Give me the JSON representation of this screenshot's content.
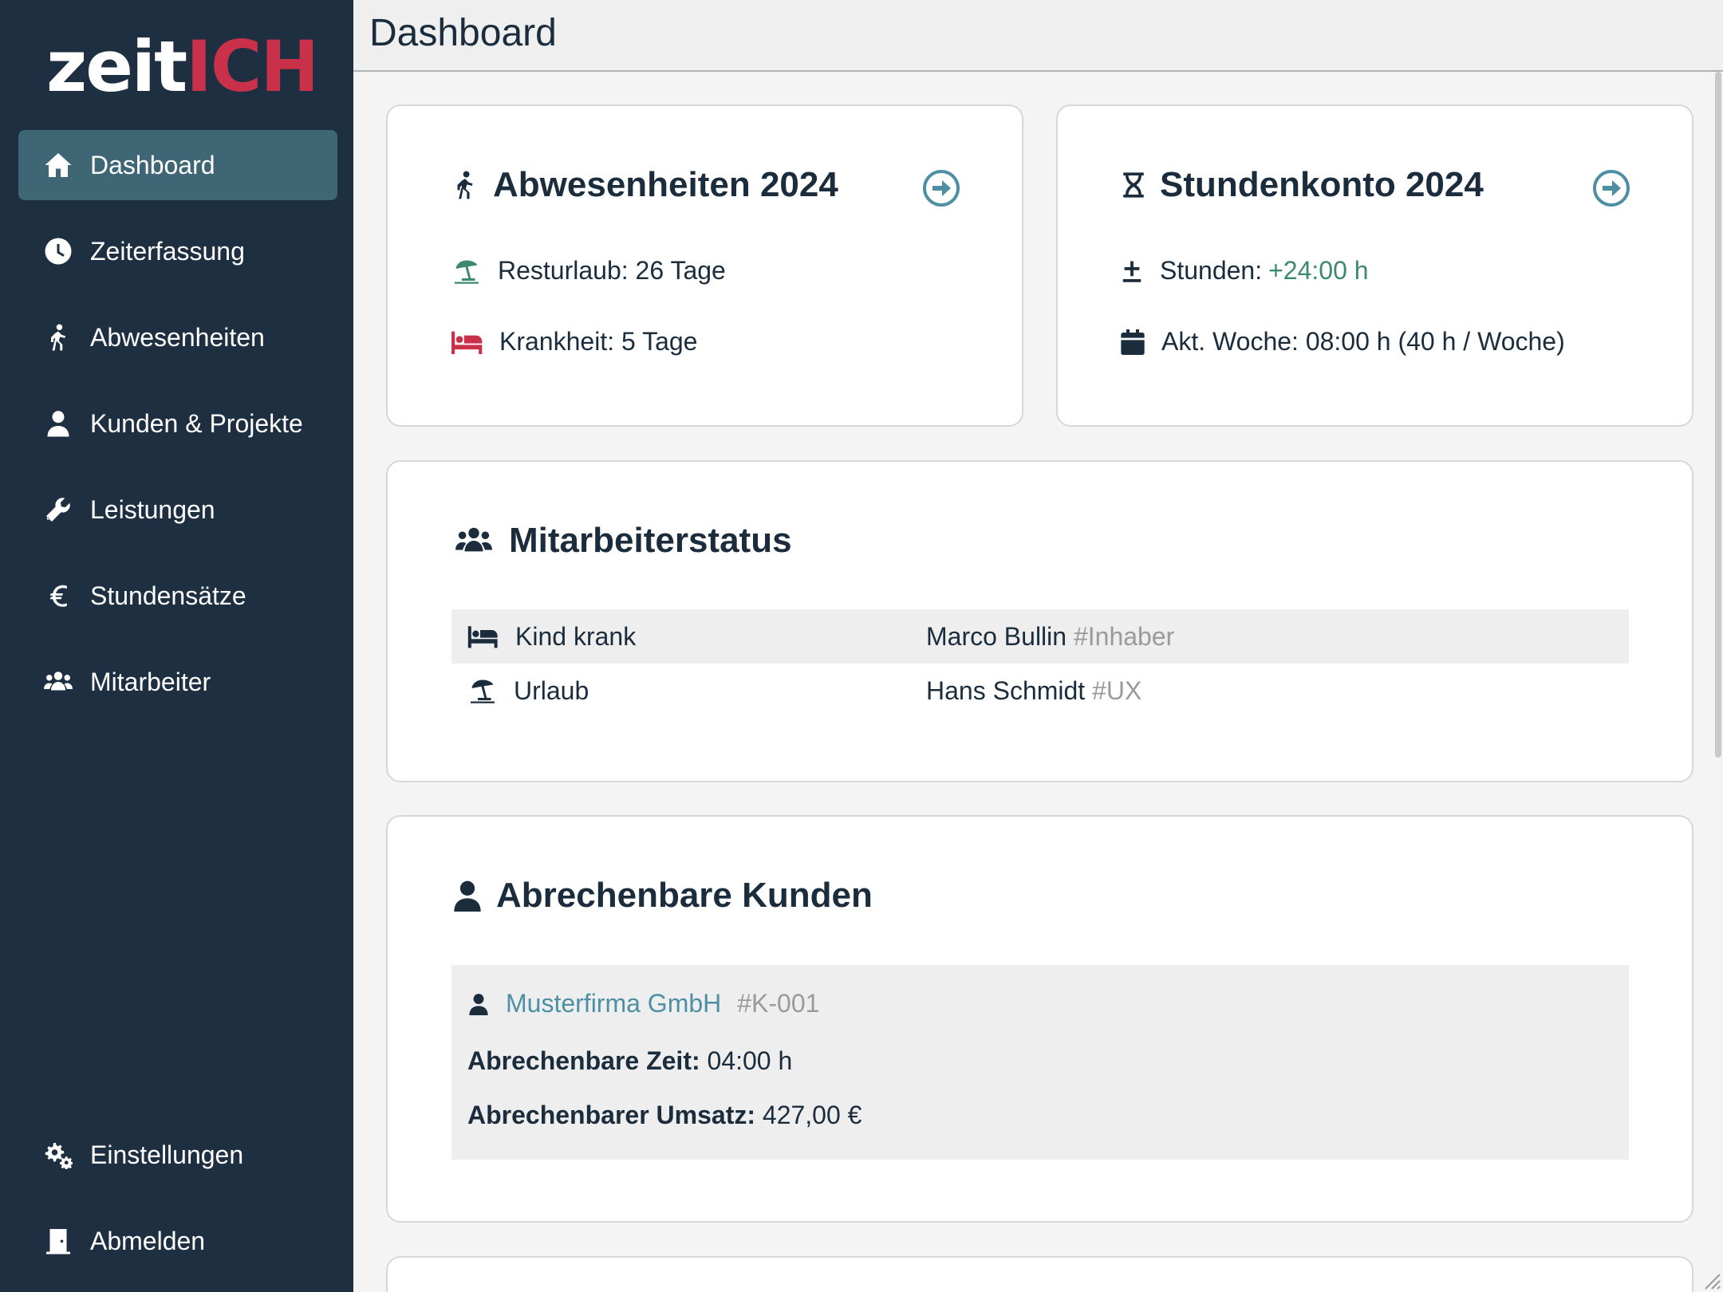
{
  "brand": {
    "logo_part1": "zeit",
    "logo_part2": "ICH"
  },
  "sidebar": {
    "items": [
      {
        "label": "Dashboard",
        "icon": "home-icon",
        "active": true
      },
      {
        "label": "Zeiterfassung",
        "icon": "clock-icon"
      },
      {
        "label": "Abwesenheiten",
        "icon": "walking-person-icon"
      },
      {
        "label": "Kunden & Projekte",
        "icon": "user-icon"
      },
      {
        "label": "Leistungen",
        "icon": "wrench-icon"
      },
      {
        "label": "Stundensätze",
        "icon": "euro-icon"
      },
      {
        "label": "Mitarbeiter",
        "icon": "users-icon"
      }
    ],
    "bottom_items": [
      {
        "label": "Einstellungen",
        "icon": "gears-icon"
      },
      {
        "label": "Abmelden",
        "icon": "door-icon"
      }
    ]
  },
  "header": {
    "title": "Dashboard"
  },
  "absences_card": {
    "title": "Abwesenheiten 2024",
    "vacation": "Resturlaub: 26 Tage",
    "sickness": "Krankheit: 5 Tage"
  },
  "hours_card": {
    "title": "Stundenkonto 2024",
    "hours_label": "Stunden: ",
    "hours_value": "+24:00 h",
    "week": "Akt. Woche: 08:00 h (40 h / Woche)"
  },
  "staff_card": {
    "title": "Mitarbeiterstatus",
    "rows": [
      {
        "status": "Kind krank",
        "name": "Marco Bullin",
        "tag": "#Inhaber"
      },
      {
        "status": "Urlaub",
        "name": "Hans Schmidt",
        "tag": "#UX"
      }
    ]
  },
  "billing_card": {
    "title": "Abrechenbare Kunden",
    "client_name": "Musterfirma GmbH",
    "client_id": "#K-001",
    "time_label": "Abrechenbare Zeit:",
    "time_value": "04:00 h",
    "revenue_label": "Abrechenbarer Umsatz:",
    "revenue_value": "427,00 €"
  },
  "colors": {
    "sidebar_bg": "#1d2f40",
    "active_item": "#3e6675",
    "brand_red": "#c9304a",
    "accent_teal": "#4f8fa4",
    "positive_green": "#3c8a6e"
  }
}
